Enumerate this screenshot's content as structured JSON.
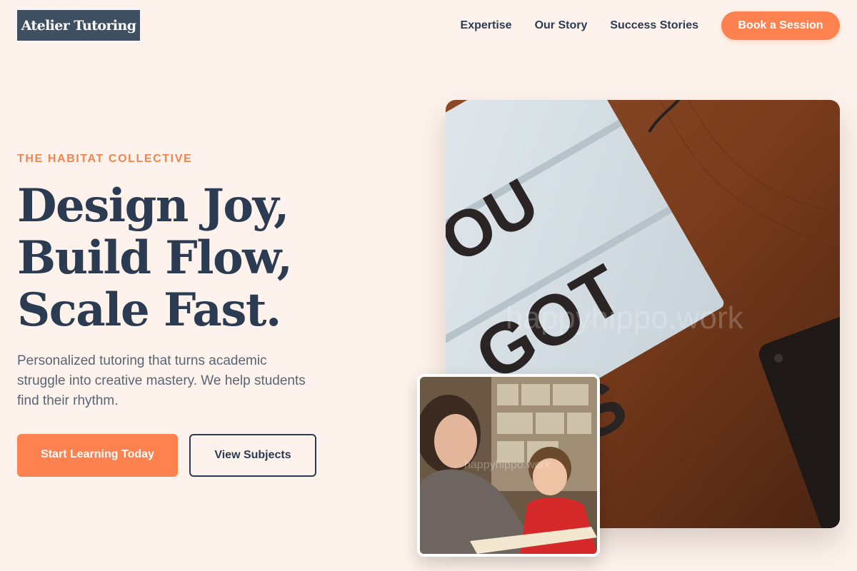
{
  "header": {
    "logo": "Atelier Tutoring",
    "nav": [
      "Expertise",
      "Our Story",
      "Success Stories"
    ],
    "cta": "Book a Session"
  },
  "hero": {
    "eyebrow": "THE HABITAT COLLECTIVE",
    "headline": [
      "Design Joy,",
      "Build Flow,",
      "Scale Fast."
    ],
    "subtext": "Personalized tutoring that turns academic struggle into creative mastery. We help students find their rhythm.",
    "primary_button": "Start Learning Today",
    "secondary_button": "View Subjects"
  },
  "images": {
    "main_lightbox_text": [
      "OU",
      "GOT",
      "HIS"
    ],
    "main_watermark": "happyhippo.work",
    "secondary_watermark": "happyhippo.work"
  },
  "colors": {
    "background": "#fdf3ec",
    "accent": "#fe8150",
    "navy": "#2b3b52",
    "logo_bg": "#3f4f62"
  }
}
